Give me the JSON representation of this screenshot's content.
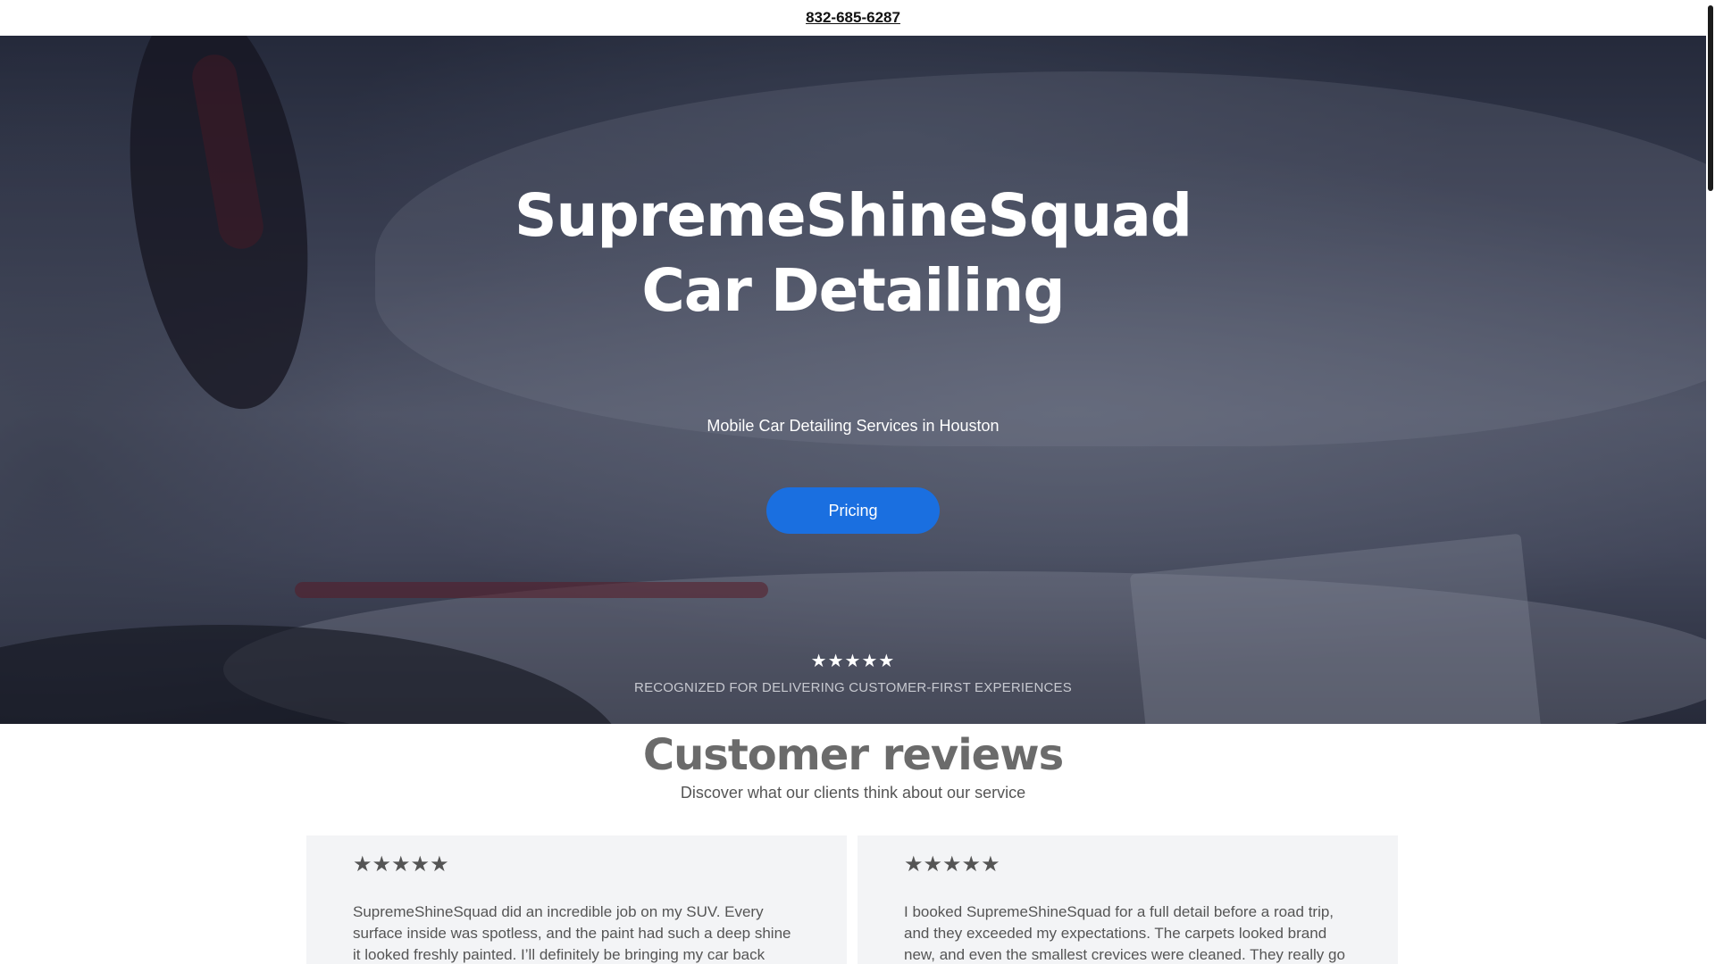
{
  "topbar": {
    "phone": "832-685-6287"
  },
  "hero": {
    "title_line1": "SupremeShineSquad",
    "title_line2": "Car Detailing",
    "subtitle": "Mobile Car Detailing Services in Houston",
    "cta_label": "Pricing",
    "stars": "★★★★★",
    "rating": 5,
    "recognized": "RECOGNIZED FOR DELIVERING CUSTOMER-FIRST EXPERIENCES"
  },
  "reviews": {
    "heading": "Customer reviews",
    "subheading": "Discover what our clients think about our service",
    "items": [
      {
        "stars": "★★★★★",
        "rating": 5,
        "text": "SupremeShineSquad did an incredible job on my SUV. Every surface inside was spotless, and the paint had such a deep shine it looked freshly painted. I’ll definitely be bringing my car back"
      },
      {
        "stars": "★★★★★",
        "rating": 5,
        "text": "I booked SupremeShineSquad for a full detail before a road trip, and they exceeded my expectations. The carpets looked brand new, and even the smallest crevices were cleaned. They really go"
      }
    ]
  },
  "colors": {
    "accent": "#1a6fe0",
    "hero_text": "#ffffff",
    "card_bg": "#f3f4f6",
    "heading_gray": "#6b6b6b"
  }
}
